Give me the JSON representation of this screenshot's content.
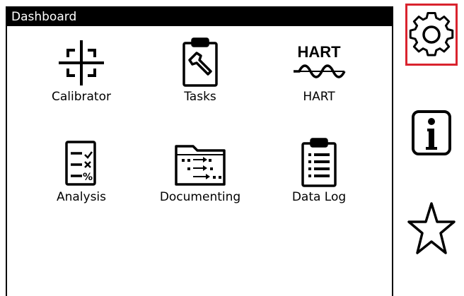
{
  "window": {
    "title": "Dashboard"
  },
  "apps": [
    {
      "label": "Calibrator",
      "icon": "calibrator-crosshair-icon"
    },
    {
      "label": "Tasks",
      "icon": "clipboard-wrench-icon"
    },
    {
      "label": "HART",
      "icon": "hart-wave-icon",
      "icon_text": "HART"
    },
    {
      "label": "Analysis",
      "icon": "checklist-icon"
    },
    {
      "label": "Documenting",
      "icon": "folder-arrows-icon"
    },
    {
      "label": "Data Log",
      "icon": "clipboard-list-icon"
    }
  ],
  "sidebar": [
    {
      "name": "settings",
      "icon": "gear-icon",
      "selected": true
    },
    {
      "name": "info",
      "icon": "info-icon",
      "selected": false
    },
    {
      "name": "favorites",
      "icon": "star-icon",
      "selected": false
    }
  ],
  "colors": {
    "selection": "#d9232e",
    "title_bg": "#000000"
  }
}
